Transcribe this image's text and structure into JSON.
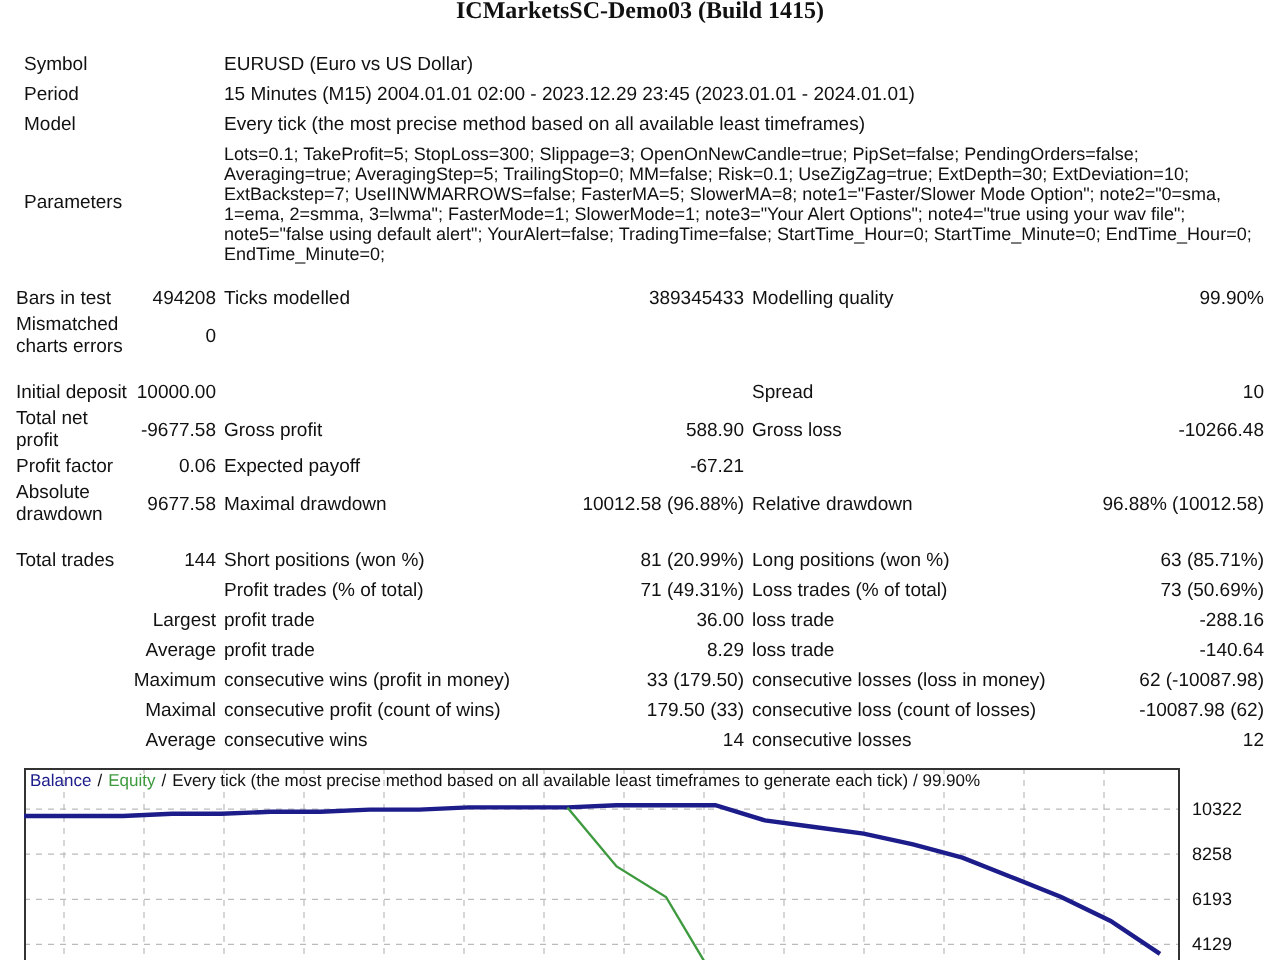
{
  "title": "ICMarketsSC-Demo03 (Build 1415)",
  "info": [
    {
      "label": "Symbol",
      "value": "EURUSD (Euro vs US Dollar)"
    },
    {
      "label": "Period",
      "value": "15 Minutes (M15) 2004.01.01 02:00 - 2023.12.29 23:45 (2023.01.01 - 2024.01.01)"
    },
    {
      "label": "Model",
      "value": "Every tick (the most precise method based on all available least timeframes)"
    },
    {
      "label": "Parameters",
      "value": "Lots=0.1; TakeProfit=5; StopLoss=300; Slippage=3; OpenOnNewCandle=true; PipSet=false; PendingOrders=false; Averaging=true; AveragingStep=5; TrailingStop=0; MM=false; Risk=0.1; UseZigZag=true; ExtDepth=30; ExtDeviation=10; ExtBackstep=7; UseIINWMARROWS=false; FasterMA=5; SlowerMA=8; note1=\"Faster/Slower Mode Option\"; note2=\"0=sma, 1=ema, 2=smma, 3=lwma\"; FasterMode=1; SlowerMode=1; note3=\"Your Alert Options\"; note4=\"true using your wav file\"; note5=\"false using default alert\"; YourAlert=false; TradingTime=false; StartTime_Hour=0; StartTime_Minute=0; EndTime_Hour=0; EndTime_Minute=0;"
    }
  ],
  "sections": [
    {
      "rows": [
        {
          "kind": "standard",
          "col_a": {
            "label": "Bars in test",
            "value": "494208"
          },
          "col_b": {
            "label": "Ticks modelled",
            "value": "389345433"
          },
          "col_c": {
            "label": "Modelling quality",
            "value": "99.90%"
          }
        },
        {
          "kind": "standard",
          "col_a": {
            "label": "Mismatched charts errors",
            "value": "0"
          }
        }
      ]
    },
    {
      "rows": [
        {
          "kind": "standard",
          "col_a": {
            "label": "Initial deposit",
            "value": "10000.00"
          },
          "col_c": {
            "label": "Spread",
            "value": "10"
          }
        },
        {
          "kind": "standard",
          "col_a": {
            "label": "Total net profit",
            "value": "-9677.58"
          },
          "col_b": {
            "label": "Gross profit",
            "value": "588.90"
          },
          "col_c": {
            "label": "Gross loss",
            "value": "-10266.48"
          }
        },
        {
          "kind": "standard",
          "col_a": {
            "label": "Profit factor",
            "value": "0.06"
          },
          "col_b": {
            "label": "Expected payoff",
            "value": "-67.21"
          }
        },
        {
          "kind": "standard",
          "col_a": {
            "label": "Absolute drawdown",
            "value": "9677.58"
          },
          "col_b": {
            "label": "Maximal drawdown",
            "value": "10012.58 (96.88%)"
          },
          "col_c": {
            "label": "Relative drawdown",
            "value": "96.88% (10012.58)"
          }
        }
      ]
    },
    {
      "rows": [
        {
          "kind": "standard",
          "col_a": {
            "label": "Total trades",
            "value": "144"
          },
          "col_b": {
            "label": "Short positions (won %)",
            "value": "81 (20.99%)"
          },
          "col_c": {
            "label": "Long positions (won %)",
            "value": "63 (85.71%)"
          }
        },
        {
          "kind": "detail",
          "col_b": {
            "label": "Profit trades (% of total)",
            "value": "71 (49.31%)"
          },
          "col_c": {
            "label": "Loss trades (% of total)",
            "value": "73 (50.69%)"
          }
        },
        {
          "kind": "detail",
          "heading": "Largest",
          "col_b": {
            "label": "profit trade",
            "value": "36.00"
          },
          "col_c": {
            "label": "loss trade",
            "value": "-288.16"
          }
        },
        {
          "kind": "detail",
          "heading": "Average",
          "col_b": {
            "label": "profit trade",
            "value": "8.29"
          },
          "col_c": {
            "label": "loss trade",
            "value": "-140.64"
          }
        },
        {
          "kind": "detail",
          "heading": "Maximum",
          "col_b": {
            "label": "consecutive wins (profit in money)",
            "value": "33 (179.50)"
          },
          "col_c": {
            "label": "consecutive losses (loss in money)",
            "value": "62 (-10087.98)"
          }
        },
        {
          "kind": "detail",
          "heading": "Maximal",
          "col_b": {
            "label": "consecutive profit (count of wins)",
            "value": "179.50 (33)"
          },
          "col_c": {
            "label": "consecutive loss (count of losses)",
            "value": "-10087.98 (62)"
          }
        },
        {
          "kind": "detail",
          "heading": "Average",
          "col_b": {
            "label": "consecutive wins",
            "value": "14"
          },
          "col_c": {
            "label": "consecutive losses",
            "value": "12"
          }
        }
      ]
    }
  ],
  "chart": {
    "legend_separator": "/",
    "chart_data": {
      "type": "line",
      "title": "Every tick (the most precise method based on all available least timeframes to generate each tick) / 99.90%",
      "grid": true,
      "series": [
        {
          "name": "Balance",
          "color": "#1c1c8a",
          "values": [
            10000,
            10000,
            10000,
            10100,
            10100,
            10200,
            10200,
            10300,
            10300,
            10400,
            10400,
            10400,
            10500,
            10500,
            10500,
            9800,
            9500,
            9200,
            8700,
            8100,
            7200,
            6300,
            5200,
            3700
          ]
        },
        {
          "name": "Equity",
          "color": "#3e9a3e",
          "values": [
            null,
            null,
            null,
            null,
            null,
            null,
            null,
            null,
            null,
            null,
            null,
            10400,
            7700,
            6300,
            2500,
            null,
            null,
            null,
            null,
            null,
            null,
            null,
            null,
            null
          ]
        }
      ],
      "ylim": [
        2500,
        12200
      ],
      "yticks": [
        10322,
        8258,
        6193,
        4129
      ]
    }
  }
}
